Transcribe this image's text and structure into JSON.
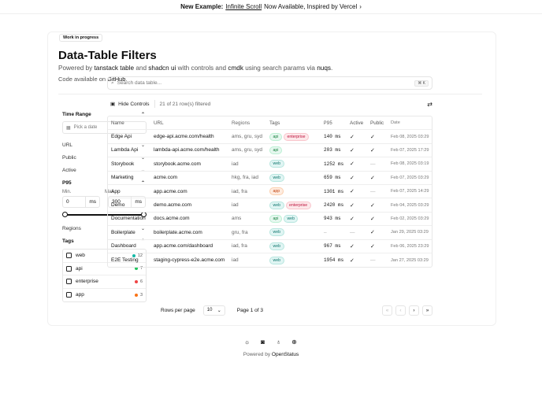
{
  "banner": {
    "prefix": "New Example:",
    "link": "Infinite Scroll",
    "suffix": "Now Available, Inspired by Vercel",
    "arrow": "›"
  },
  "header": {
    "badge": "Work in progress",
    "title": "Data-Table Filters",
    "subtitle_parts": [
      "Powered by",
      "tanstack table",
      "and",
      "shadcn ui",
      "with controls and",
      "cmdk",
      "using search params via",
      "nuqs",
      "."
    ],
    "code_prefix": "Code available on",
    "code_link": "GitHub",
    "code_suffix": "."
  },
  "sidebar": {
    "time_range": "Time Range",
    "date_placeholder": "Pick a date",
    "url": "URL",
    "public": "Public",
    "active": "Active",
    "p95": "P95",
    "min_label": "Min.",
    "max_label": "Max.",
    "min_value": "0",
    "max_value": "300",
    "unit": "ms",
    "slider_min_frac": 0,
    "slider_max_frac": 1,
    "regions": "Regions",
    "tags_title": "Tags",
    "tags": [
      {
        "label": "web",
        "count": "12",
        "color": "#14b8a6"
      },
      {
        "label": "api",
        "count": "7",
        "color": "#22c55e"
      },
      {
        "label": "enterprise",
        "count": "6",
        "color": "#ef4444"
      },
      {
        "label": "app",
        "count": "3",
        "color": "#f97316"
      }
    ]
  },
  "search": {
    "placeholder": "Search data table...",
    "shortcut": "⌘ K"
  },
  "toolbar": {
    "hide_controls": "Hide Controls",
    "filtered": "21 of 21 row(s) filtered"
  },
  "table": {
    "headers": [
      "Name",
      "URL",
      "Regions",
      "Tags",
      "P95",
      "Active",
      "Public",
      "Date"
    ],
    "rows": [
      {
        "name": "Edge Api",
        "url": "edge-api.acme.com/health",
        "regions": "ams, gru, syd",
        "tags": [
          "api",
          "enterprise"
        ],
        "p95": "140 ms",
        "active": true,
        "public": true,
        "date": "Feb 08, 2025 03:29"
      },
      {
        "name": "Lambda Api",
        "url": "lambda-api.acme.com/health",
        "regions": "ams, gru, syd",
        "tags": [
          "api"
        ],
        "p95": "203 ms",
        "active": true,
        "public": true,
        "date": "Feb 07, 2025 17:29"
      },
      {
        "name": "Storybook",
        "url": "storybook.acme.com",
        "regions": "iad",
        "tags": [
          "web"
        ],
        "p95": "1252 ms",
        "active": true,
        "public": false,
        "date": "Feb 08, 2025 03:19"
      },
      {
        "name": "Marketing",
        "url": "acme.com",
        "regions": "hkg, fra, iad",
        "tags": [
          "web"
        ],
        "p95": "659 ms",
        "active": true,
        "public": true,
        "date": "Feb 07, 2025 03:29"
      },
      {
        "name": "App",
        "url": "app.acme.com",
        "regions": "iad, fra",
        "tags": [
          "app"
        ],
        "p95": "1301 ms",
        "active": true,
        "public": false,
        "date": "Feb 07, 2025 14:29"
      },
      {
        "name": "Demo",
        "url": "demo.acme.com",
        "regions": "iad",
        "tags": [
          "web",
          "enterprise"
        ],
        "p95": "2420 ms",
        "active": true,
        "public": true,
        "date": "Feb 04, 2025 03:29"
      },
      {
        "name": "Documentation",
        "url": "docs.acme.com",
        "regions": "ams",
        "tags": [
          "api",
          "web"
        ],
        "p95": "943 ms",
        "active": true,
        "public": true,
        "date": "Feb 02, 2025 03:29"
      },
      {
        "name": "Boilerplate",
        "url": "boilerplate.acme.com",
        "regions": "gru, fra",
        "tags": [
          "web"
        ],
        "p95": "—",
        "active": false,
        "public": true,
        "date": "Jan 29, 2025 03:29"
      },
      {
        "name": "Dashboard",
        "url": "app.acme.com/dashboard",
        "regions": "iad, fra",
        "tags": [
          "web"
        ],
        "p95": "967 ms",
        "active": true,
        "public": true,
        "date": "Feb 06, 2025 23:29"
      },
      {
        "name": "E2E Testing",
        "url": "staging-cypress-e2e.acme.com",
        "regions": "iad",
        "tags": [
          "web"
        ],
        "p95": "1954 ms",
        "active": true,
        "public": false,
        "date": "Jan 27, 2025 03:29"
      }
    ],
    "tag_colors": {
      "api": {
        "bg": "#e6f7ef",
        "fg": "#15803d",
        "border": "#bbf0d3"
      },
      "web": {
        "bg": "#e0f5f3",
        "fg": "#0f766e",
        "border": "#b7e6df"
      },
      "enterprise": {
        "bg": "#fde8ea",
        "fg": "#be123c",
        "border": "#f9c5cc"
      },
      "app": {
        "bg": "#feece0",
        "fg": "#c2410c",
        "border": "#fbcfae"
      }
    }
  },
  "pager": {
    "rows_per_page": "Rows per page",
    "page_size": "10",
    "page_info": "Page 1 of 3"
  },
  "footer": {
    "powered_prefix": "Powered by",
    "powered_link": "OpenStatus"
  }
}
